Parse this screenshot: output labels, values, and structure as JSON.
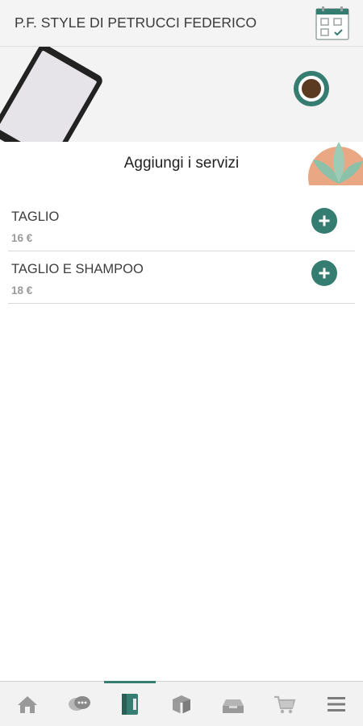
{
  "header": {
    "title": "P.F. STYLE DI PETRUCCI FEDERICO",
    "calendar_icon": "calendar-checklist-icon"
  },
  "banner": {
    "caption": "Aggiungi i servizi",
    "illustrations": [
      "tablet-icon",
      "coffee-cup-icon",
      "plant-icon"
    ]
  },
  "services": [
    {
      "name": "TAGLIO",
      "price": "16 €",
      "action_icon": "plus-icon"
    },
    {
      "name": "TAGLIO E SHAMPOO",
      "price": "18 €",
      "action_icon": "plus-icon"
    }
  ],
  "tabbar": {
    "active_index": 2,
    "tabs": [
      {
        "icon": "home-icon"
      },
      {
        "icon": "chat-icon"
      },
      {
        "icon": "services-book-icon"
      },
      {
        "icon": "products-icon"
      },
      {
        "icon": "inbox-icon"
      },
      {
        "icon": "cart-icon"
      },
      {
        "icon": "menu-icon"
      }
    ]
  },
  "colors": {
    "accent": "#357d70",
    "header_bg": "#f4f4f4",
    "tabbar_bg": "#f2f2f2"
  }
}
